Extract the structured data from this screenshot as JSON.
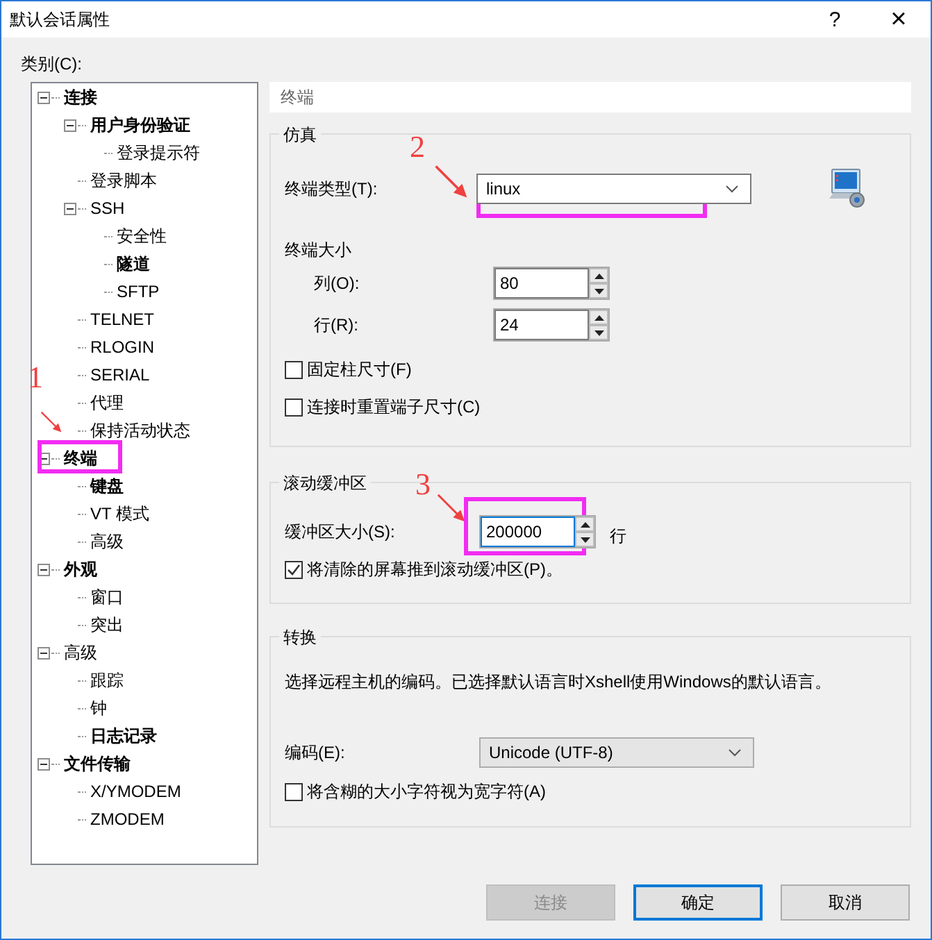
{
  "window": {
    "title": "默认会话属性",
    "help": "?",
    "close": "×"
  },
  "category_label": "类别(C):",
  "tree": [
    {
      "label": "连接",
      "bold": true,
      "expanded": true,
      "children": [
        {
          "label": "用户身份验证",
          "bold": true,
          "expanded": true,
          "children": [
            {
              "label": "登录提示符",
              "bold": false
            }
          ]
        },
        {
          "label": "登录脚本",
          "bold": false
        },
        {
          "label": "SSH",
          "bold": false,
          "expanded": true,
          "children": [
            {
              "label": "安全性",
              "bold": false
            },
            {
              "label": "隧道",
              "bold": true
            },
            {
              "label": "SFTP",
              "bold": false
            }
          ]
        },
        {
          "label": "TELNET",
          "bold": false
        },
        {
          "label": "RLOGIN",
          "bold": false
        },
        {
          "label": "SERIAL",
          "bold": false
        },
        {
          "label": "代理",
          "bold": false
        },
        {
          "label": "保持活动状态",
          "bold": false
        }
      ]
    },
    {
      "label": "终端",
      "bold": true,
      "expanded": true,
      "children": [
        {
          "label": "键盘",
          "bold": true
        },
        {
          "label": "VT 模式",
          "bold": false
        },
        {
          "label": "高级",
          "bold": false
        }
      ]
    },
    {
      "label": "外观",
      "bold": true,
      "expanded": true,
      "children": [
        {
          "label": "窗口",
          "bold": false
        },
        {
          "label": "突出",
          "bold": false
        }
      ]
    },
    {
      "label": "高级",
      "bold": false,
      "expanded": true,
      "children": [
        {
          "label": "跟踪",
          "bold": false
        },
        {
          "label": "钟",
          "bold": false
        },
        {
          "label": "日志记录",
          "bold": true
        }
      ]
    },
    {
      "label": "文件传输",
      "bold": true,
      "expanded": true,
      "children": [
        {
          "label": "X/YMODEM",
          "bold": false
        },
        {
          "label": "ZMODEM",
          "bold": false
        }
      ]
    }
  ],
  "page_title": "终端",
  "emulation": {
    "title": "仿真",
    "terminal_type_label": "终端类型(T):",
    "terminal_type": "linux",
    "size_title": "终端大小",
    "columns_label": "列(O):",
    "columns": "80",
    "rows_label": "行(R):",
    "rows": "24",
    "checkboxes": [
      {
        "label": "固定柱尺寸(F)",
        "checked": false
      },
      {
        "label": "连接时重置端子尺寸(C)",
        "checked": false
      }
    ]
  },
  "scrollback": {
    "title": "滚动缓冲区",
    "size_label": "缓冲区大小(S):",
    "size": "200000",
    "unit": "行",
    "checkboxes": [
      {
        "label": "将清除的屏幕推到滚动缓冲区(P)。",
        "checked": true
      }
    ]
  },
  "translation": {
    "title": "转换",
    "description": "选择远程主机的编码。已选择默认语言时Xshell使用Windows的默认语言。",
    "encoding_label": "编码(E):",
    "encoding": "Unicode (UTF-8)",
    "checkboxes": [
      {
        "label": "将含糊的大小字符视为宽字符(A)",
        "checked": false
      }
    ]
  },
  "buttons": [
    {
      "label": "连接",
      "disabled": true,
      "focused": false
    },
    {
      "label": "确定",
      "disabled": false,
      "focused": true
    },
    {
      "label": "取消",
      "disabled": false,
      "focused": false
    }
  ],
  "annotations": [
    {
      "label": "1"
    },
    {
      "label": "2"
    },
    {
      "label": "3"
    }
  ]
}
